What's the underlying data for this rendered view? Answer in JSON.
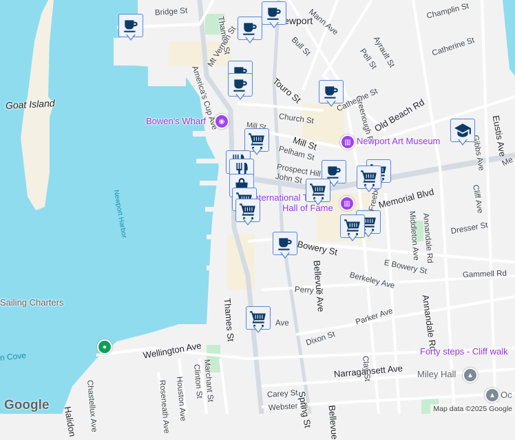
{
  "map": {
    "places": {
      "goat_island": "Goat Island",
      "newport": "Newport"
    },
    "water_labels": {
      "harbor": "Newport Harbor",
      "cove": "n Cove"
    },
    "streets": {
      "bridge": "Bridge St",
      "thames_top": "Thames St",
      "americas_cup": "America's Cup Ave",
      "touro": "Touro St",
      "mt_vernon": "Mt Vernon St",
      "mann": "Mann Ave",
      "bull": "Bull St",
      "pell": "Pell St",
      "ayrault": "Ayrault St",
      "champlin": "Champlin St",
      "catherine1": "Catherine St",
      "catherine2": "Catherine St",
      "greenough": "Greenough Pl",
      "old_beach": "Old Beach Rd",
      "church": "Church St",
      "mill_small": "Mill St",
      "mill": "Mill St",
      "pelham": "Pelham St",
      "prospect": "Prospect Hill",
      "john": "John St",
      "memorial": "Memorial Blvd",
      "eustis": "Eustis Ave",
      "gibbs": "Gibbs Ave",
      "cliff": "Cliff Ave",
      "middleton": "Middleton Ave",
      "annandale1": "Annandale Rd",
      "annandale2": "Annandale Rd",
      "freebody": "Freebody St",
      "dresser": "Dresser St",
      "bowery": "Bowery St",
      "e_bowery": "E Bowery St",
      "gammell": "Gammell Rd",
      "berkeley": "Berkeley Ave",
      "perry": "Perry St",
      "thames_low": "Thames St",
      "bellevue1": "Bellevue Ave",
      "bellevue2": "Bellevue",
      "parker": "Parker Ave",
      "ave_partial": "Ave",
      "dixon": "Dixon St",
      "clay": "Clay St",
      "wellington": "Wellington Ave",
      "chastellux": "Chastellux Ave",
      "roseneath": "Roseneath Ave",
      "houston": "Houston Ave",
      "clinton": "Clinton St",
      "marchant": "Marchant St",
      "narragansett": "Narragansett Ave",
      "carey": "Carey St",
      "webster": "Webster St",
      "spring": "Spring St",
      "halidon": "Halidon",
      "mem_partial": "Me"
    },
    "pois": {
      "bowens_wharf": "Bowen's Wharf",
      "art_museum": "Newport Art Museum",
      "tennis_line1": "International Tennis",
      "tennis_line2": "Hall of Fame",
      "forty_steps": "Forty steps - Cliff walk",
      "miley_hall": "Miley Hall",
      "sailing": "Sailing Charters",
      "oc_partial": "Oc"
    },
    "markers": [
      {
        "icon": "coffee"
      },
      {
        "icon": "coffee"
      },
      {
        "icon": "coffee"
      },
      {
        "icon": "coffee"
      },
      {
        "icon": "coffee"
      },
      {
        "icon": "coffee"
      },
      {
        "icon": "coffee"
      },
      {
        "icon": "cart"
      },
      {
        "icon": "cart"
      },
      {
        "icon": "cart"
      },
      {
        "icon": "cart"
      },
      {
        "icon": "cart"
      },
      {
        "icon": "cart"
      },
      {
        "icon": "restaurant"
      },
      {
        "icon": "shopping-bag"
      },
      {
        "icon": "cart"
      },
      {
        "icon": "graduation-cap"
      }
    ],
    "logo": "Google",
    "attribution": "Map data ©2025 Google",
    "colors": {
      "water": "#8fdcee",
      "land": "#f2f2f3",
      "marker": "#0d3b66",
      "poi": "#9334e6"
    }
  }
}
